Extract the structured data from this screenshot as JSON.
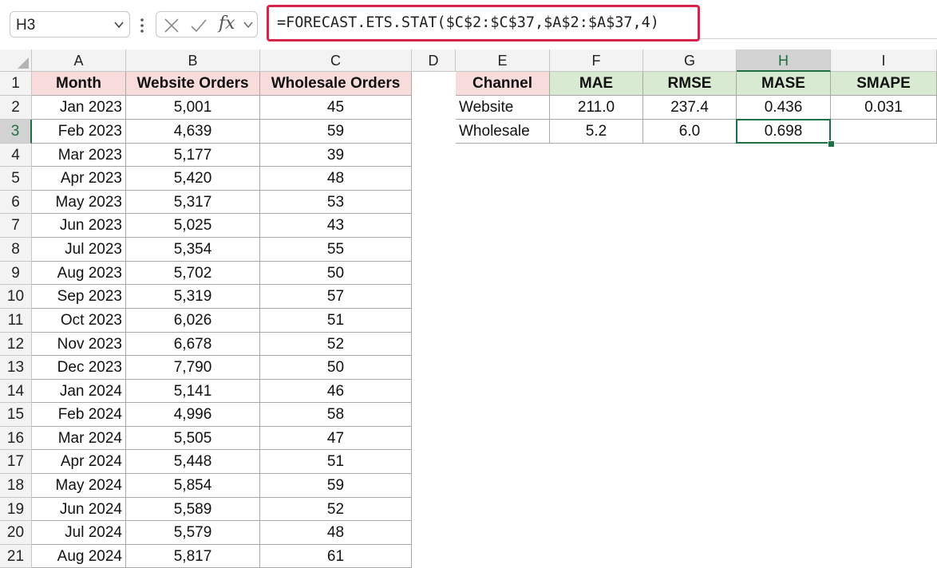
{
  "namebox": {
    "value": "H3"
  },
  "formula": {
    "text": "=FORECAST.ETS.STAT($C$2:$C$37,$A$2:$A$37,4)"
  },
  "columns": [
    "A",
    "B",
    "C",
    "D",
    "E",
    "F",
    "G",
    "H",
    "I"
  ],
  "selected_column": "H",
  "selected_row": "3",
  "rows": [
    "1",
    "2",
    "3",
    "4",
    "5",
    "6",
    "7",
    "8",
    "9",
    "10",
    "11",
    "12",
    "13",
    "14",
    "15",
    "16",
    "17",
    "18",
    "19",
    "20",
    "21"
  ],
  "table1": {
    "headers": [
      "Month",
      "Website Orders",
      "Wholesale Orders"
    ],
    "data": [
      [
        "Jan 2023",
        "5,001",
        "45"
      ],
      [
        "Feb 2023",
        "4,639",
        "59"
      ],
      [
        "Mar 2023",
        "5,177",
        "39"
      ],
      [
        "Apr 2023",
        "5,420",
        "48"
      ],
      [
        "May 2023",
        "5,317",
        "53"
      ],
      [
        "Jun 2023",
        "5,025",
        "43"
      ],
      [
        "Jul 2023",
        "5,354",
        "55"
      ],
      [
        "Aug 2023",
        "5,702",
        "50"
      ],
      [
        "Sep 2023",
        "5,319",
        "57"
      ],
      [
        "Oct 2023",
        "6,026",
        "51"
      ],
      [
        "Nov 2023",
        "6,678",
        "52"
      ],
      [
        "Dec 2023",
        "7,790",
        "50"
      ],
      [
        "Jan 2024",
        "5,141",
        "46"
      ],
      [
        "Feb 2024",
        "4,996",
        "58"
      ],
      [
        "Mar 2024",
        "5,505",
        "47"
      ],
      [
        "Apr 2024",
        "5,448",
        "51"
      ],
      [
        "May 2024",
        "5,854",
        "59"
      ],
      [
        "Jun 2024",
        "5,589",
        "52"
      ],
      [
        "Jul 2024",
        "5,579",
        "48"
      ],
      [
        "Aug 2024",
        "5,817",
        "61"
      ]
    ]
  },
  "table2": {
    "headers": [
      "Channel",
      "MAE",
      "RMSE",
      "MASE",
      "SMAPE"
    ],
    "data": [
      [
        "Website",
        "211.0",
        "237.4",
        "0.436",
        "0.031"
      ],
      [
        "Wholesale",
        "5.2",
        "6.0",
        "0.698",
        ""
      ]
    ]
  },
  "colors": {
    "formula_highlight": "#d6244b",
    "selection": "#1e7145",
    "header_pink": "#f8dcdc",
    "header_green": "#d9ead3"
  },
  "icons": {
    "namebox_dropdown": "chevron-down-icon",
    "more": "vertical-dots-icon",
    "cancel": "x-icon",
    "enter": "checkmark-icon",
    "insert_function": "fx-icon",
    "fx_dropdown": "chevron-down-icon",
    "select_all": "triangle-icon"
  }
}
